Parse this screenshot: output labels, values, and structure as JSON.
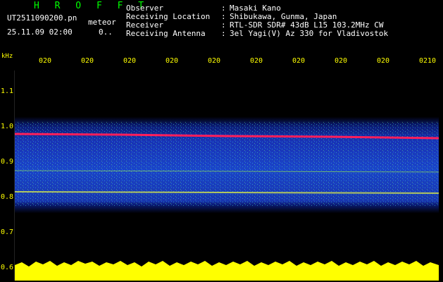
{
  "header": {
    "brand": "H R O F F T",
    "filename": "UT2511090200.pn",
    "mode": "meteor",
    "datetime": "25.11.09 02:00",
    "detections": "0.."
  },
  "info": [
    {
      "label": "Observer",
      "value": "Masaki Kano"
    },
    {
      "label": "Receiving Location",
      "value": "Shibukawa, Gunma, Japan"
    },
    {
      "label": "Receiver",
      "value": "RTL-SDR SDR# 43dB L15 103.2MHz CW"
    },
    {
      "label": "Receiving Antenna",
      "value": "3el Yagi(V) Az 330 for Vladivostok"
    }
  ],
  "axis": {
    "unit": "kHz",
    "y_ticks": [
      "1.1",
      "1.0",
      "0.9",
      "0.8",
      "0.7",
      "0.6"
    ],
    "x_ticks": [
      "020",
      "020",
      "020",
      "020",
      "020",
      "020",
      "020",
      "020",
      "020",
      "0210"
    ]
  },
  "colors": {
    "label": "#ffff00",
    "brand": "#00ff00",
    "noise": "#1428c8",
    "signal": "#ff1e5a",
    "envelope": "#ffff00"
  }
}
